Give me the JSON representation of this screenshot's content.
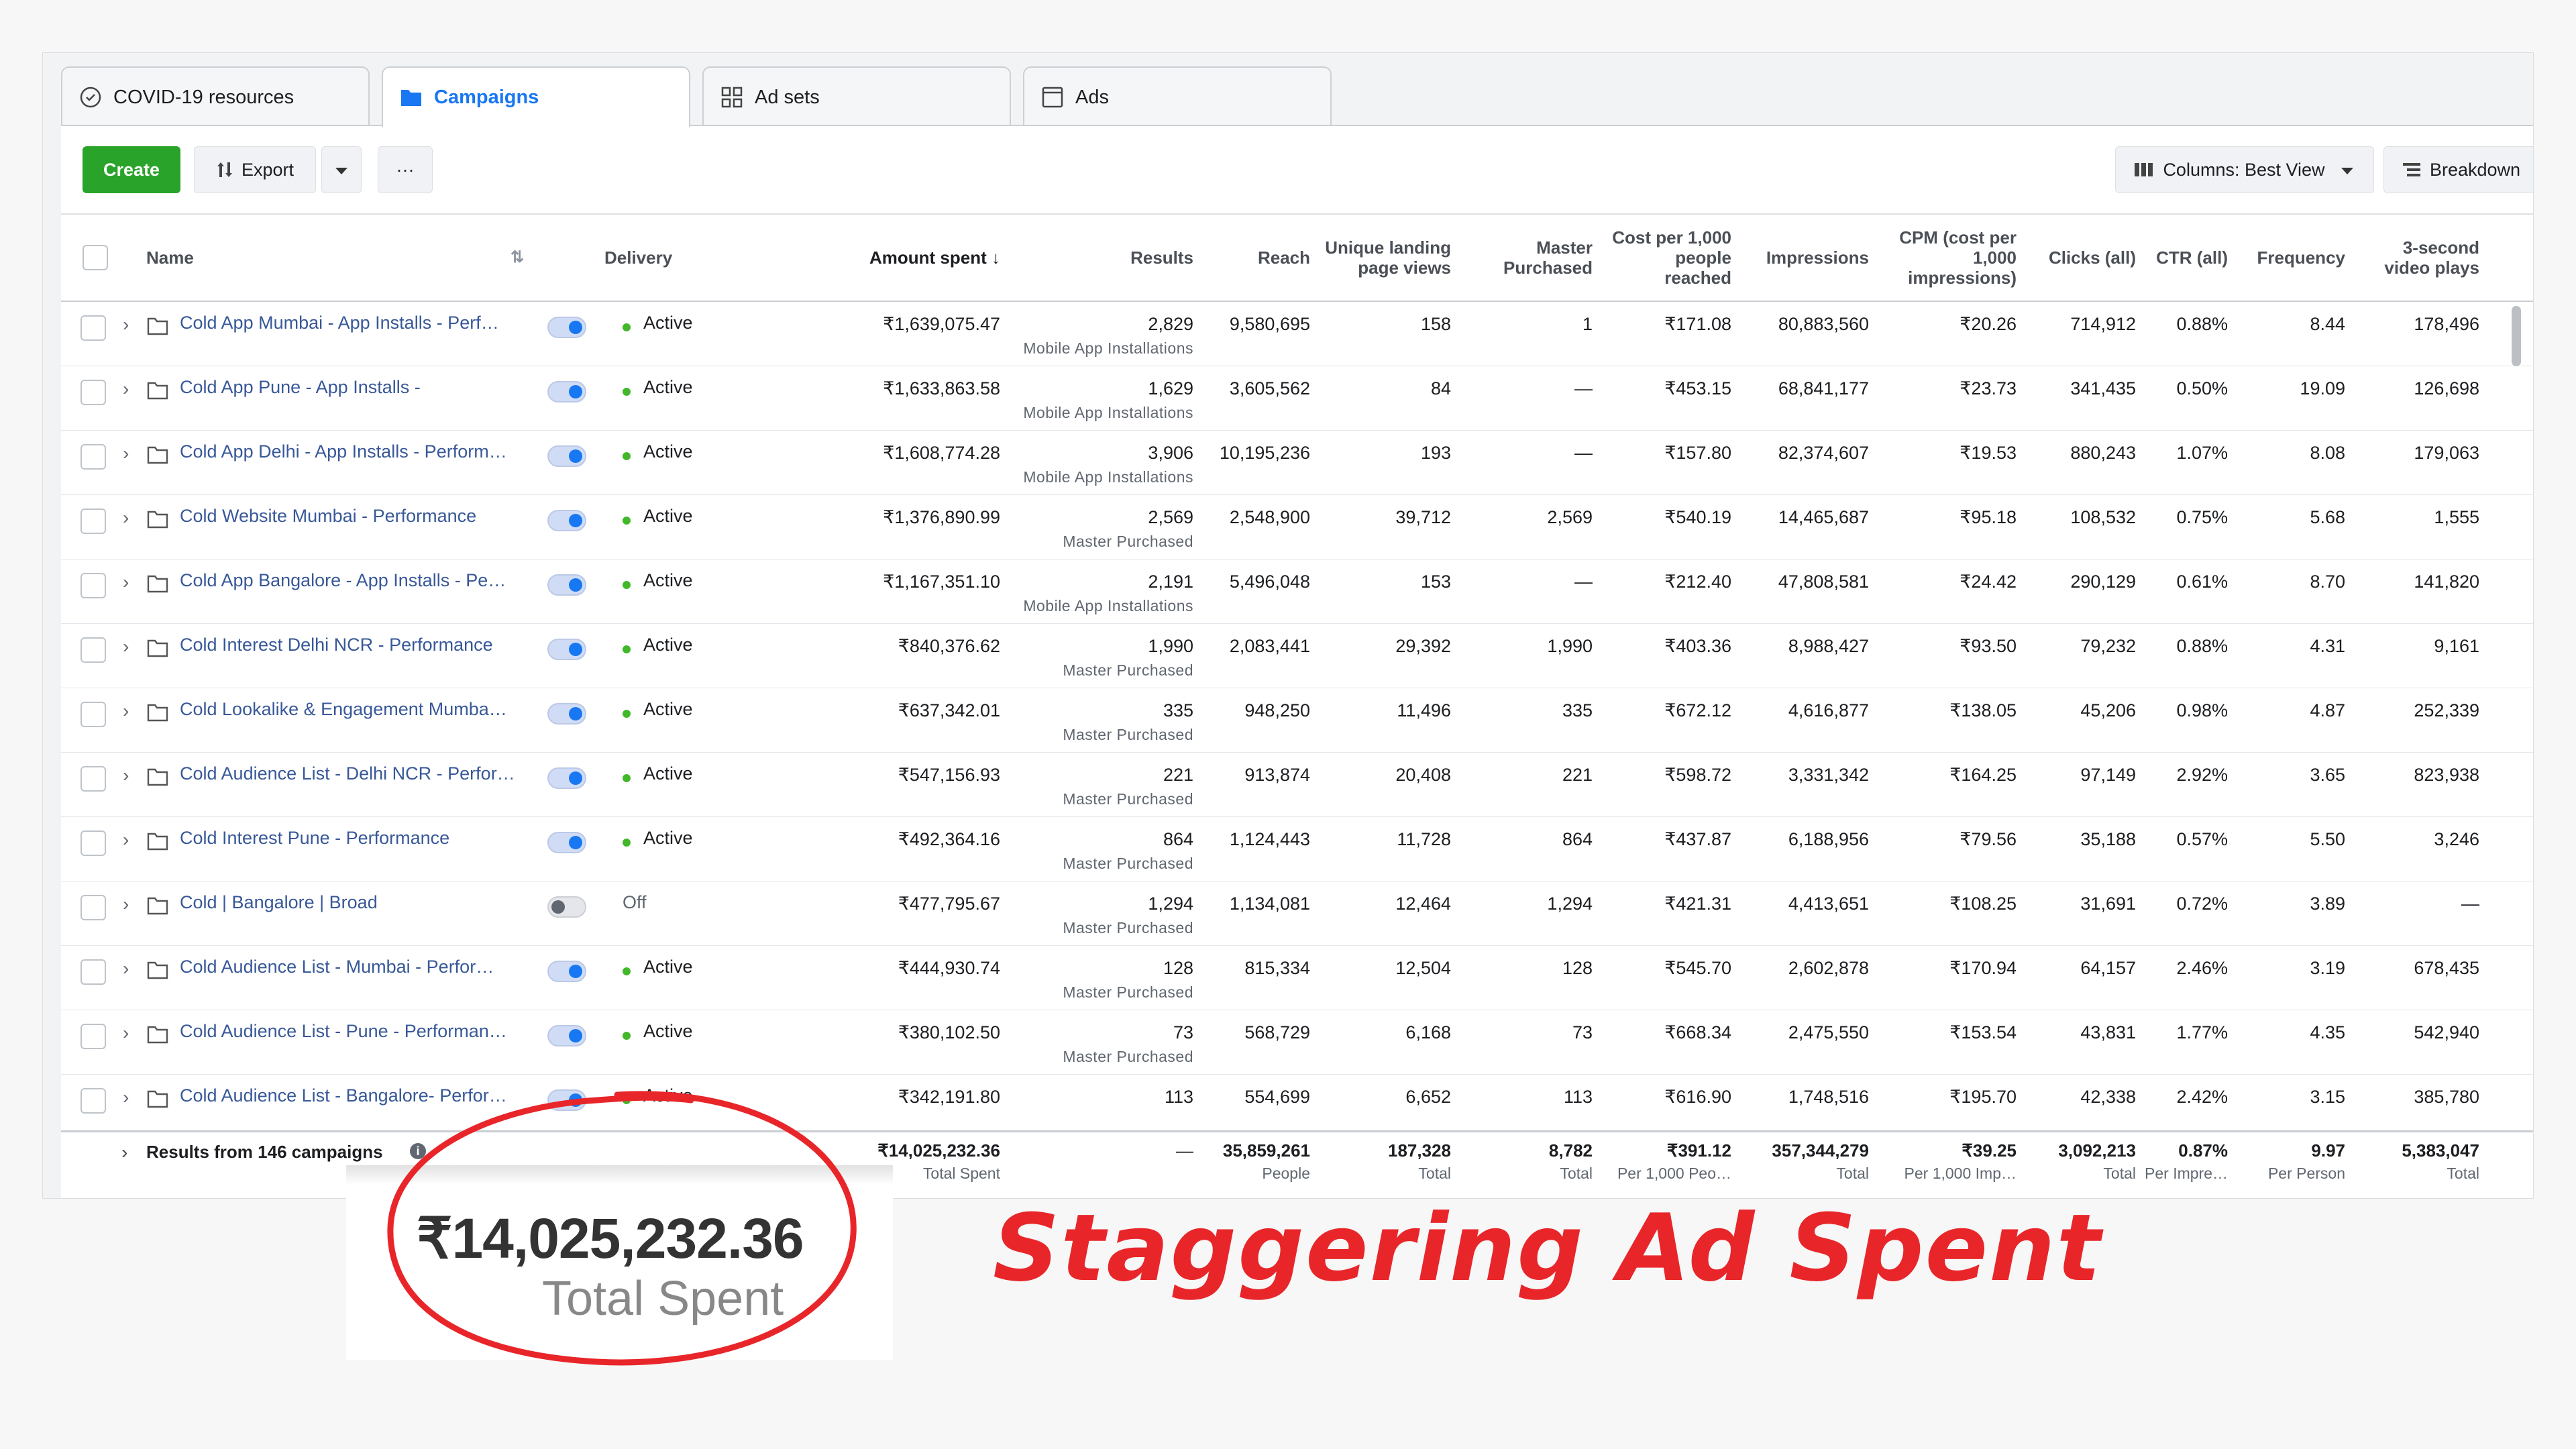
{
  "tabs": [
    {
      "label": "COVID-19 resources",
      "icon": "covid-shield-icon"
    },
    {
      "label": "Campaigns",
      "icon": "folder-icon"
    },
    {
      "label": "Ad sets",
      "icon": "grid-icon"
    },
    {
      "label": "Ads",
      "icon": "ad-window-icon"
    }
  ],
  "toolbar": {
    "create_label": "Create",
    "export_label": "Export",
    "more_label": "···",
    "columns_label": "Columns: Best View",
    "breakdown_label": "Breakdown"
  },
  "columns": {
    "name": "Name",
    "delivery": "Delivery",
    "amount_spent": "Amount spent ↓",
    "results": "Results",
    "reach": "Reach",
    "unique_lpv": "Unique landing page views",
    "master_purchased": "Master Purchased",
    "cost_per_1000_reached": "Cost per 1,000 people reached",
    "impressions": "Impressions",
    "cpm": "CPM (cost per 1,000 impressions)",
    "clicks": "Clicks (all)",
    "ctr": "CTR (all)",
    "frequency": "Frequency",
    "video_plays": "3-second video plays"
  },
  "rows": [
    {
      "name": "Cold App Mumbai - App Installs - Perf…",
      "delivery": "Active",
      "on": true,
      "spent": "₹1,639,075.47",
      "results": "2,829",
      "result_type": "Mobile App Installations",
      "reach": "9,580,695",
      "lpv": "158",
      "mp": "1",
      "cpr": "₹171.08",
      "impr": "80,883,560",
      "cpm": "₹20.26",
      "clicks": "714,912",
      "ctr": "0.88%",
      "freq": "8.44",
      "vp": "178,496"
    },
    {
      "name": "Cold App Pune - App Installs -",
      "delivery": "Active",
      "on": true,
      "spent": "₹1,633,863.58",
      "results": "1,629",
      "result_type": "Mobile App Installations",
      "reach": "3,605,562",
      "lpv": "84",
      "mp": "—",
      "cpr": "₹453.15",
      "impr": "68,841,177",
      "cpm": "₹23.73",
      "clicks": "341,435",
      "ctr": "0.50%",
      "freq": "19.09",
      "vp": "126,698"
    },
    {
      "name": "Cold App Delhi - App Installs - Perform…",
      "delivery": "Active",
      "on": true,
      "spent": "₹1,608,774.28",
      "results": "3,906",
      "result_type": "Mobile App Installations",
      "reach": "10,195,236",
      "lpv": "193",
      "mp": "—",
      "cpr": "₹157.80",
      "impr": "82,374,607",
      "cpm": "₹19.53",
      "clicks": "880,243",
      "ctr": "1.07%",
      "freq": "8.08",
      "vp": "179,063"
    },
    {
      "name": "Cold Website Mumbai - Performance",
      "delivery": "Active",
      "on": true,
      "spent": "₹1,376,890.99",
      "results": "2,569",
      "result_type": "Master Purchased",
      "reach": "2,548,900",
      "lpv": "39,712",
      "mp": "2,569",
      "cpr": "₹540.19",
      "impr": "14,465,687",
      "cpm": "₹95.18",
      "clicks": "108,532",
      "ctr": "0.75%",
      "freq": "5.68",
      "vp": "1,555"
    },
    {
      "name": "Cold App Bangalore - App Installs - Pe…",
      "delivery": "Active",
      "on": true,
      "spent": "₹1,167,351.10",
      "results": "2,191",
      "result_type": "Mobile App Installations",
      "reach": "5,496,048",
      "lpv": "153",
      "mp": "—",
      "cpr": "₹212.40",
      "impr": "47,808,581",
      "cpm": "₹24.42",
      "clicks": "290,129",
      "ctr": "0.61%",
      "freq": "8.70",
      "vp": "141,820"
    },
    {
      "name": "Cold Interest Delhi NCR - Performance",
      "delivery": "Active",
      "on": true,
      "spent": "₹840,376.62",
      "results": "1,990",
      "result_type": "Master Purchased",
      "reach": "2,083,441",
      "lpv": "29,392",
      "mp": "1,990",
      "cpr": "₹403.36",
      "impr": "8,988,427",
      "cpm": "₹93.50",
      "clicks": "79,232",
      "ctr": "0.88%",
      "freq": "4.31",
      "vp": "9,161"
    },
    {
      "name": "Cold Lookalike & Engagement Mumba…",
      "delivery": "Active",
      "on": true,
      "spent": "₹637,342.01",
      "results": "335",
      "result_type": "Master Purchased",
      "reach": "948,250",
      "lpv": "11,496",
      "mp": "335",
      "cpr": "₹672.12",
      "impr": "4,616,877",
      "cpm": "₹138.05",
      "clicks": "45,206",
      "ctr": "0.98%",
      "freq": "4.87",
      "vp": "252,339"
    },
    {
      "name": "Cold Audience List - Delhi NCR - Perfor…",
      "delivery": "Active",
      "on": true,
      "spent": "₹547,156.93",
      "results": "221",
      "result_type": "Master Purchased",
      "reach": "913,874",
      "lpv": "20,408",
      "mp": "221",
      "cpr": "₹598.72",
      "impr": "3,331,342",
      "cpm": "₹164.25",
      "clicks": "97,149",
      "ctr": "2.92%",
      "freq": "3.65",
      "vp": "823,938"
    },
    {
      "name": "Cold Interest Pune - Performance",
      "delivery": "Active",
      "on": true,
      "spent": "₹492,364.16",
      "results": "864",
      "result_type": "Master Purchased",
      "reach": "1,124,443",
      "lpv": "11,728",
      "mp": "864",
      "cpr": "₹437.87",
      "impr": "6,188,956",
      "cpm": "₹79.56",
      "clicks": "35,188",
      "ctr": "0.57%",
      "freq": "5.50",
      "vp": "3,246"
    },
    {
      "name": "Cold | Bangalore | Broad",
      "delivery": "Off",
      "on": false,
      "spent": "₹477,795.67",
      "results": "1,294",
      "result_type": "Master Purchased",
      "reach": "1,134,081",
      "lpv": "12,464",
      "mp": "1,294",
      "cpr": "₹421.31",
      "impr": "4,413,651",
      "cpm": "₹108.25",
      "clicks": "31,691",
      "ctr": "0.72%",
      "freq": "3.89",
      "vp": "—"
    },
    {
      "name": "Cold Audience List - Mumbai - Perfor…",
      "delivery": "Active",
      "on": true,
      "spent": "₹444,930.74",
      "results": "128",
      "result_type": "Master Purchased",
      "reach": "815,334",
      "lpv": "12,504",
      "mp": "128",
      "cpr": "₹545.70",
      "impr": "2,602,878",
      "cpm": "₹170.94",
      "clicks": "64,157",
      "ctr": "2.46%",
      "freq": "3.19",
      "vp": "678,435"
    },
    {
      "name": "Cold Audience List - Pune - Performan…",
      "delivery": "Active",
      "on": true,
      "spent": "₹380,102.50",
      "results": "73",
      "result_type": "Master Purchased",
      "reach": "568,729",
      "lpv": "6,168",
      "mp": "73",
      "cpr": "₹668.34",
      "impr": "2,475,550",
      "cpm": "₹153.54",
      "clicks": "43,831",
      "ctr": "1.77%",
      "freq": "4.35",
      "vp": "542,940"
    },
    {
      "name": "Cold Audience List - Bangalore- Perfor…",
      "delivery": "Active",
      "on": true,
      "spent": "₹342,191.80",
      "results": "113",
      "result_type": "",
      "reach": "554,699",
      "lpv": "6,652",
      "mp": "113",
      "cpr": "₹616.90",
      "impr": "1,748,516",
      "cpm": "₹195.70",
      "clicks": "42,338",
      "ctr": "2.42%",
      "freq": "3.15",
      "vp": "385,780"
    }
  ],
  "totals": {
    "label": "Results from 146 campaigns",
    "spent": "₹14,025,232.36",
    "spent_label": "Total Spent",
    "results": "—",
    "reach": "35,859,261",
    "reach_label": "People",
    "lpv": "187,328",
    "lpv_label": "Total",
    "mp": "8,782",
    "mp_label": "Total",
    "cpr": "₹391.12",
    "cpr_label": "Per 1,000 Peo…",
    "impr": "357,344,279",
    "impr_label": "Total",
    "cpm": "₹39.25",
    "cpm_label": "Per 1,000 Imp…",
    "clicks": "3,092,213",
    "clicks_label": "Total",
    "ctr": "0.87%",
    "ctr_label": "Per Impre…",
    "freq": "9.97",
    "freq_label": "Per Person",
    "vp": "5,383,047",
    "vp_label": "Total"
  },
  "callout": {
    "value": "₹14,025,232.36",
    "label": "Total Spent",
    "caption": "Staggering Ad Spent",
    "color": "#e8262a"
  }
}
